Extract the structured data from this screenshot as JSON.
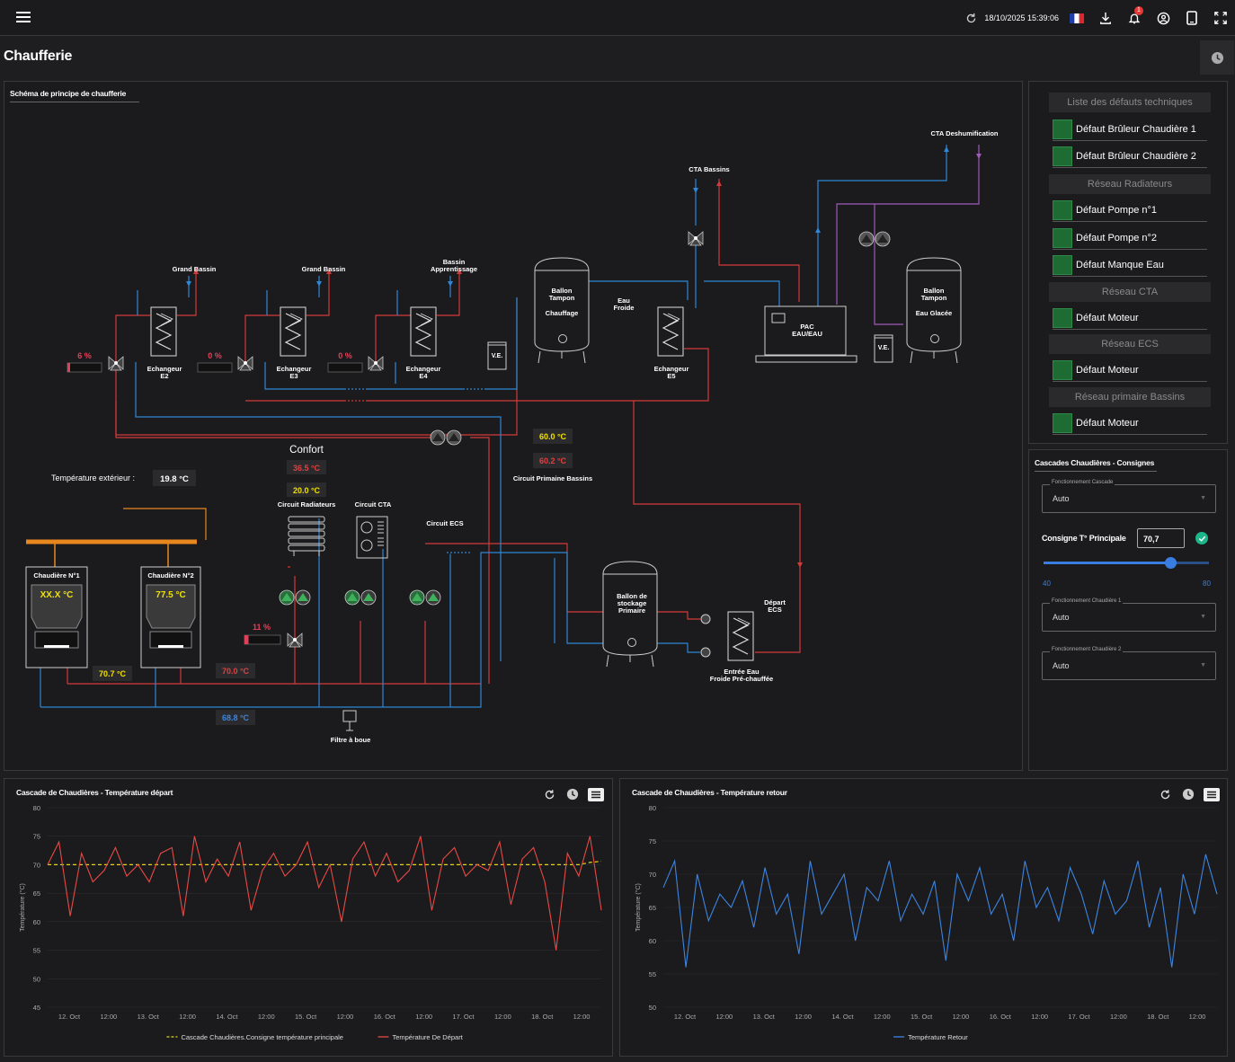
{
  "topbar": {
    "datetime": "18/10/2025 15:39:06",
    "notif_count": "1"
  },
  "page_title": "Chaufferie",
  "schematic": {
    "title": "Schéma de principe de chaufferie",
    "labels": {
      "grand_bassin_1": "Grand Bassin",
      "grand_bassin_2": "Grand Bassin",
      "bassin_app_1": "Bassin",
      "bassin_app_2": "Apprentissage",
      "cta_bassins": "CTA Bassins",
      "cta_deshum": "CTA Deshumification",
      "ech_e2_1": "Echangeur",
      "ech_e2_2": "E2",
      "ech_e3_1": "Echangeur",
      "ech_e3_2": "E3",
      "ech_e4_1": "Echangeur",
      "ech_e4_2": "E4",
      "ech_e5_1": "Echangeur",
      "ech_e5_2": "E5",
      "ballon_tampon_chauffage_1": "Ballon",
      "ballon_tampon_chauffage_2": "Tampon",
      "ballon_tampon_chauffage_3": "Chauffage",
      "eau_froide_1": "Eau",
      "eau_froide_2": "Froide",
      "pac_1": "PAC",
      "pac_2": "EAU/EAU",
      "ballon_eau_glacee_1": "Ballon",
      "ballon_eau_glacee_2": "Tampon",
      "ballon_eau_glacee_3": "Eau Glacée",
      "ve_1": "V.E.",
      "ve_2": "V.E.",
      "confort": "Confort",
      "temp_ext_label": "Température extérieur :",
      "circuit_radiateurs": "Circuit Radiateurs",
      "circuit_cta": "Circuit CTA",
      "circuit_ecs": "Circuit ECS",
      "circuit_primaire_bassins": "Circuit Primaine Bassins",
      "chaudiere_1": "Chaudière N°1",
      "chaudiere_2": "Chaudière N°2",
      "ballon_stockage_1": "Ballon de",
      "ballon_stockage_2": "stockage",
      "ballon_stockage_3": "Primaire",
      "depart_ecs_1": "Départ",
      "depart_ecs_2": "ECS",
      "entree_eau_1": "Entrée Eau",
      "entree_eau_2": "Froide Pré-chauffée",
      "filtre": "Filtre à boue"
    },
    "values": {
      "vanne_e2": "6 %",
      "vanne_e3": "0 %",
      "vanne_e4": "0 %",
      "vanne_rad": "11 %",
      "temp_ext": "19.8 °C",
      "confort_red": "36.5 °C",
      "confort_yellow": "20.0 °C",
      "bassins_yellow": "60.0 °C",
      "bassins_red": "60.2 °C",
      "chaudiere_1": "XX.X °C",
      "chaudiere_2": "77.5 °C",
      "depart_yellow": "70.7 °C",
      "depart_red": "70.0 °C",
      "retour_blue": "68.8 °C"
    }
  },
  "faults": {
    "title": "Liste des défauts techniques",
    "sections": [
      {
        "header": null,
        "items": [
          "Défaut Brûleur Chaudière 1",
          "Défaut Brûleur Chaudière 2"
        ]
      },
      {
        "header": "Réseau Radiateurs",
        "items": [
          "Défaut Pompe n°1",
          "Défaut Pompe n°2",
          "Défaut Manque Eau"
        ]
      },
      {
        "header": "Réseau CTA",
        "items": [
          "Défaut Moteur"
        ]
      },
      {
        "header": "Réseau ECS",
        "items": [
          "Défaut Moteur"
        ]
      },
      {
        "header": "Réseau primaire Bassins",
        "items": [
          "Défaut Moteur"
        ]
      }
    ]
  },
  "cascade": {
    "title": "Cascades Chaudières - Consignes",
    "fonct_cascade_label": "Fonctionnement Cascade",
    "fonct_cascade_value": "Auto",
    "consigne_label": "Consigne T° Principale",
    "consigne_value": "70,7",
    "slider_min": "40",
    "slider_max": "80",
    "slider_value": 70.7,
    "fonct_ch1_label": "Fonctionnement Chaudière 1",
    "fonct_ch1_value": "Auto",
    "fonct_ch2_label": "Fonctionnement Chaudière 2",
    "fonct_ch2_value": "Auto"
  },
  "chart_data": [
    {
      "type": "line",
      "title": "Cascade de Chaudières - Température départ",
      "ylabel": "Température (°C)",
      "ylim": [
        45,
        80
      ],
      "yticks": [
        "80",
        "75",
        "70",
        "65",
        "60",
        "55",
        "50",
        "45"
      ],
      "xticks": [
        "12. Oct",
        "12:00",
        "13. Oct",
        "12:00",
        "14. Oct",
        "12:00",
        "15. Oct",
        "12:00",
        "16. Oct",
        "12:00",
        "17. Oct",
        "12:00",
        "18. Oct",
        "12:00"
      ],
      "series": [
        {
          "name": "Cascade Chaudières.Consigne température principale",
          "color": "#e8d31c",
          "dashed": true,
          "values": [
            70,
            70,
            70,
            70,
            70,
            70,
            70,
            70,
            70,
            70,
            70,
            70,
            70,
            70,
            70,
            70,
            70,
            70,
            70,
            70,
            70,
            70,
            70,
            70,
            70,
            70,
            70,
            70,
            70,
            70,
            70,
            70,
            70,
            70,
            70,
            70,
            70,
            70,
            70,
            70,
            70,
            70,
            70,
            70,
            70,
            70,
            70,
            70,
            70.4,
            70.6
          ]
        },
        {
          "name": "Température De Départ",
          "color": "#e64a45",
          "values": [
            70,
            74,
            61,
            72,
            67,
            69,
            73,
            68,
            70,
            67,
            72,
            73,
            61,
            75,
            67,
            71,
            68,
            74,
            62,
            69,
            72,
            68,
            70,
            74,
            66,
            70,
            60,
            71,
            74,
            68,
            72,
            67,
            69,
            75,
            62,
            71,
            73,
            68,
            70,
            69,
            74,
            63,
            71,
            73,
            67,
            55,
            72,
            68,
            75,
            62
          ]
        }
      ]
    },
    {
      "type": "line",
      "title": "Cascade de Chaudières - Température retour",
      "ylabel": "Température (°C)",
      "ylim": [
        50,
        80
      ],
      "yticks": [
        "80",
        "75",
        "70",
        "65",
        "60",
        "55",
        "50"
      ],
      "xticks": [
        "12. Oct",
        "12:00",
        "13. Oct",
        "12:00",
        "14. Oct",
        "12:00",
        "15. Oct",
        "12:00",
        "16. Oct",
        "12:00",
        "17. Oct",
        "12:00",
        "18. Oct",
        "12:00"
      ],
      "series": [
        {
          "name": "Température Retour",
          "color": "#3d85e0",
          "values": [
            68,
            72,
            56,
            70,
            63,
            67,
            65,
            69,
            62,
            71,
            64,
            67,
            58,
            72,
            64,
            67,
            70,
            60,
            68,
            66,
            72,
            63,
            67,
            64,
            69,
            57,
            70,
            66,
            71,
            64,
            67,
            60,
            72,
            65,
            68,
            63,
            71,
            67,
            61,
            69,
            64,
            66,
            72,
            62,
            68,
            56,
            70,
            64,
            73,
            67
          ]
        }
      ]
    }
  ]
}
